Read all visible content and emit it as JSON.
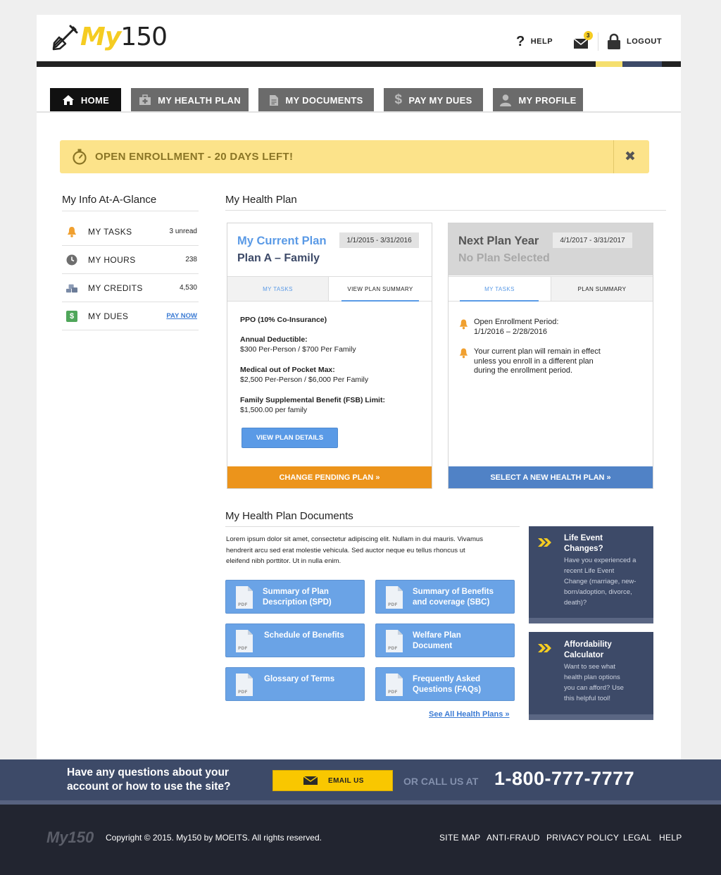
{
  "brand": {
    "logo_part1": "My",
    "logo_part2": "150",
    "accent": "#f5cc22",
    "navy": "#3d4a68"
  },
  "header": {
    "help_label": "HELP",
    "mail_badge": "3",
    "logout_label": "LOGOUT"
  },
  "nav": {
    "tabs": [
      {
        "label": "HOME",
        "icon": "home-icon",
        "active": true
      },
      {
        "label": "MY HEALTH PLAN",
        "icon": "medical-kit-icon",
        "active": false
      },
      {
        "label": "MY DOCUMENTS",
        "icon": "document-icon",
        "active": false
      },
      {
        "label": "PAY MY DUES",
        "icon": "dollar-icon",
        "active": false
      },
      {
        "label": "MY PROFILE",
        "icon": "user-icon",
        "active": false
      }
    ]
  },
  "alert": {
    "text": "OPEN ENROLLMENT - 20 DAYS LEFT!",
    "icon": "stopwatch-icon",
    "close_icon": "close-icon"
  },
  "glance": {
    "title": "My Info At-A-Glance",
    "items": [
      {
        "label": "MY TASKS",
        "value": "3 unread",
        "icon": "bell-icon"
      },
      {
        "label": "MY HOURS",
        "value": "238",
        "icon": "clock-icon"
      },
      {
        "label": "MY CREDITS",
        "value": "4,530",
        "icon": "coins-icon"
      },
      {
        "label": "MY DUES",
        "value": "PAY NOW",
        "icon": "dollar-icon"
      }
    ]
  },
  "health_plan": {
    "title": "My Health Plan",
    "current": {
      "title": "My Current Plan",
      "plan_name": "Plan A – Family",
      "dates": "1/1/2015 - 3/31/2016",
      "tab_tasks": "MY TASKS",
      "tab_summary": "VIEW PLAN SUMMARY",
      "type": "PPO (10% Co-Insurance)",
      "deductible_label": "Annual Deductible:",
      "deductible_value": "$300 Per-Person / $700 Per Family",
      "oop_label": "Medical out of Pocket Max:",
      "oop_value": "$2,500 Per-Person / $6,000 Per Family",
      "fsb_label": "Family Supplemental Benefit (FSB) Limit:",
      "fsb_value": "$1,500.00 per family",
      "details_button": "VIEW PLAN DETAILS",
      "cta": "CHANGE PENDING PLAN »"
    },
    "next": {
      "title": "Next Plan Year",
      "plan_name": "No Plan Selected",
      "dates": "4/1/2017 - 3/31/2017",
      "tab_tasks": "MY TASKS",
      "tab_summary": "PLAN SUMMARY",
      "task1_line1": "Open Enrollment Period:",
      "task1_line2": "1/1/2016 – 2/28/2016",
      "task2_line1": "Your current plan will remain in effect",
      "task2_line2": "unless you enroll in a different plan",
      "task2_line3": "during the enrollment period.",
      "cta": "SELECT A NEW HEALTH PLAN »"
    }
  },
  "documents": {
    "title": "My Health Plan Documents",
    "intro_line1": "Lorem ipsum dolor sit amet, consectetur adipiscing elit. Nullam in dui mauris. Vivamus",
    "intro_line2": "hendrerit arcu sed erat molestie vehicula. Sed auctor neque eu tellus rhoncus ut",
    "intro_line3": "eleifend nibh porttitor. Ut in nulla enim.",
    "items": [
      {
        "line1": "Summary of Plan",
        "line2": "Description (SPD)"
      },
      {
        "line1": "Summary of Benefits",
        "line2": "and coverage (SBC)"
      },
      {
        "line1": "Schedule of Benefits",
        "line2": ""
      },
      {
        "line1": "Welfare Plan",
        "line2": "Document"
      },
      {
        "line1": "Glossary of Terms",
        "line2": ""
      },
      {
        "line1": "Frequently Asked",
        "line2": "Questions (FAQs)"
      }
    ],
    "pdf_label": "PDF",
    "see_all": "See All Health Plans »"
  },
  "side_cards": [
    {
      "title1": "Life Event",
      "title2": "Changes?",
      "lines": [
        "Have you experienced a",
        "recent Life Event",
        "Change (marriage, new-",
        "born/adoption, divorce,",
        "death)?"
      ]
    },
    {
      "title1": "Affordability",
      "title2": "Calculator",
      "lines": [
        "Want to see what",
        "health plan options",
        "you can afford? Use",
        "this helpful tool!"
      ]
    }
  ],
  "contact": {
    "question_line1": "Have any questions about your",
    "question_line2": "account or how to use the site?",
    "email_button": "EMAIL US",
    "call_label": "OR CALL US AT",
    "phone": "1-800-777-7777"
  },
  "footer": {
    "logo": "My150",
    "copyright": "Copyright © 2015. My150 by MOEITS. All rights reserved.",
    "links": [
      "SITE MAP",
      "ANTI-FRAUD",
      "PRIVACY POLICY",
      "LEGAL",
      "HELP"
    ]
  }
}
